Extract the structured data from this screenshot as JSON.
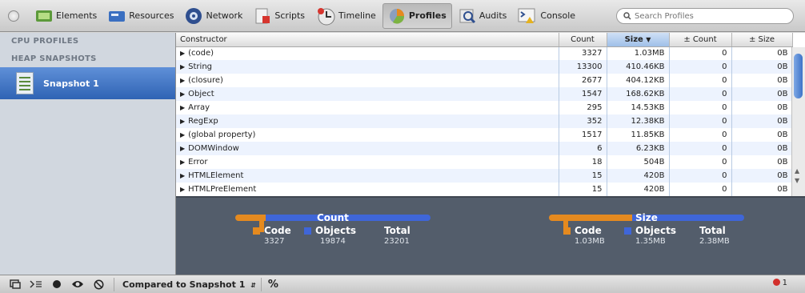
{
  "toolbar": {
    "panels": [
      {
        "label": "Elements",
        "icon": "elements-icon",
        "active": false
      },
      {
        "label": "Resources",
        "icon": "resources-icon",
        "active": false
      },
      {
        "label": "Network",
        "icon": "network-icon",
        "active": false
      },
      {
        "label": "Scripts",
        "icon": "scripts-icon",
        "active": false
      },
      {
        "label": "Timeline",
        "icon": "timeline-icon",
        "active": false
      },
      {
        "label": "Profiles",
        "icon": "profiles-icon",
        "active": true
      },
      {
        "label": "Audits",
        "icon": "audits-icon",
        "active": false
      },
      {
        "label": "Console",
        "icon": "console-icon",
        "active": false
      }
    ],
    "search_placeholder": "Search Profiles"
  },
  "sidebar": {
    "cpu_heading": "CPU PROFILES",
    "heap_heading": "HEAP SNAPSHOTS",
    "snapshot_label": "Snapshot 1"
  },
  "table": {
    "columns": [
      "Constructor",
      "Count",
      "Size",
      "± Count",
      "± Size"
    ],
    "sorted_column": "Size",
    "rows": [
      {
        "name": "(code)",
        "count": "3327",
        "size": "1.03MB",
        "dcount": "0",
        "dsize": "0B"
      },
      {
        "name": "String",
        "count": "13300",
        "size": "410.46KB",
        "dcount": "0",
        "dsize": "0B"
      },
      {
        "name": "(closure)",
        "count": "2677",
        "size": "404.12KB",
        "dcount": "0",
        "dsize": "0B"
      },
      {
        "name": "Object",
        "count": "1547",
        "size": "168.62KB",
        "dcount": "0",
        "dsize": "0B"
      },
      {
        "name": "Array",
        "count": "295",
        "size": "14.53KB",
        "dcount": "0",
        "dsize": "0B"
      },
      {
        "name": "RegExp",
        "count": "352",
        "size": "12.38KB",
        "dcount": "0",
        "dsize": "0B"
      },
      {
        "name": "(global property)",
        "count": "1517",
        "size": "11.85KB",
        "dcount": "0",
        "dsize": "0B"
      },
      {
        "name": "DOMWindow",
        "count": "6",
        "size": "6.23KB",
        "dcount": "0",
        "dsize": "0B"
      },
      {
        "name": "Error",
        "count": "18",
        "size": "504B",
        "dcount": "0",
        "dsize": "0B"
      },
      {
        "name": "HTMLElement",
        "count": "15",
        "size": "420B",
        "dcount": "0",
        "dsize": "0B"
      },
      {
        "name": "HTMLPreElement",
        "count": "15",
        "size": "420B",
        "dcount": "0",
        "dsize": "0B"
      }
    ]
  },
  "summary": {
    "count": {
      "title": "Count",
      "code_label": "Code",
      "code_value": "3327",
      "objects_label": "Objects",
      "objects_value": "19874",
      "total_label": "Total",
      "total_value": "23201"
    },
    "size": {
      "title": "Size",
      "code_label": "Code",
      "code_value": "1.03MB",
      "objects_label": "Objects",
      "objects_value": "1.35MB",
      "total_label": "Total",
      "total_value": "2.38MB"
    },
    "colors": {
      "code": "#e58a1f",
      "objects": "#3f66d8"
    }
  },
  "statusbar": {
    "compare_label": "Compared to Snapshot 1",
    "percent_label": "%",
    "error_count": "1"
  }
}
